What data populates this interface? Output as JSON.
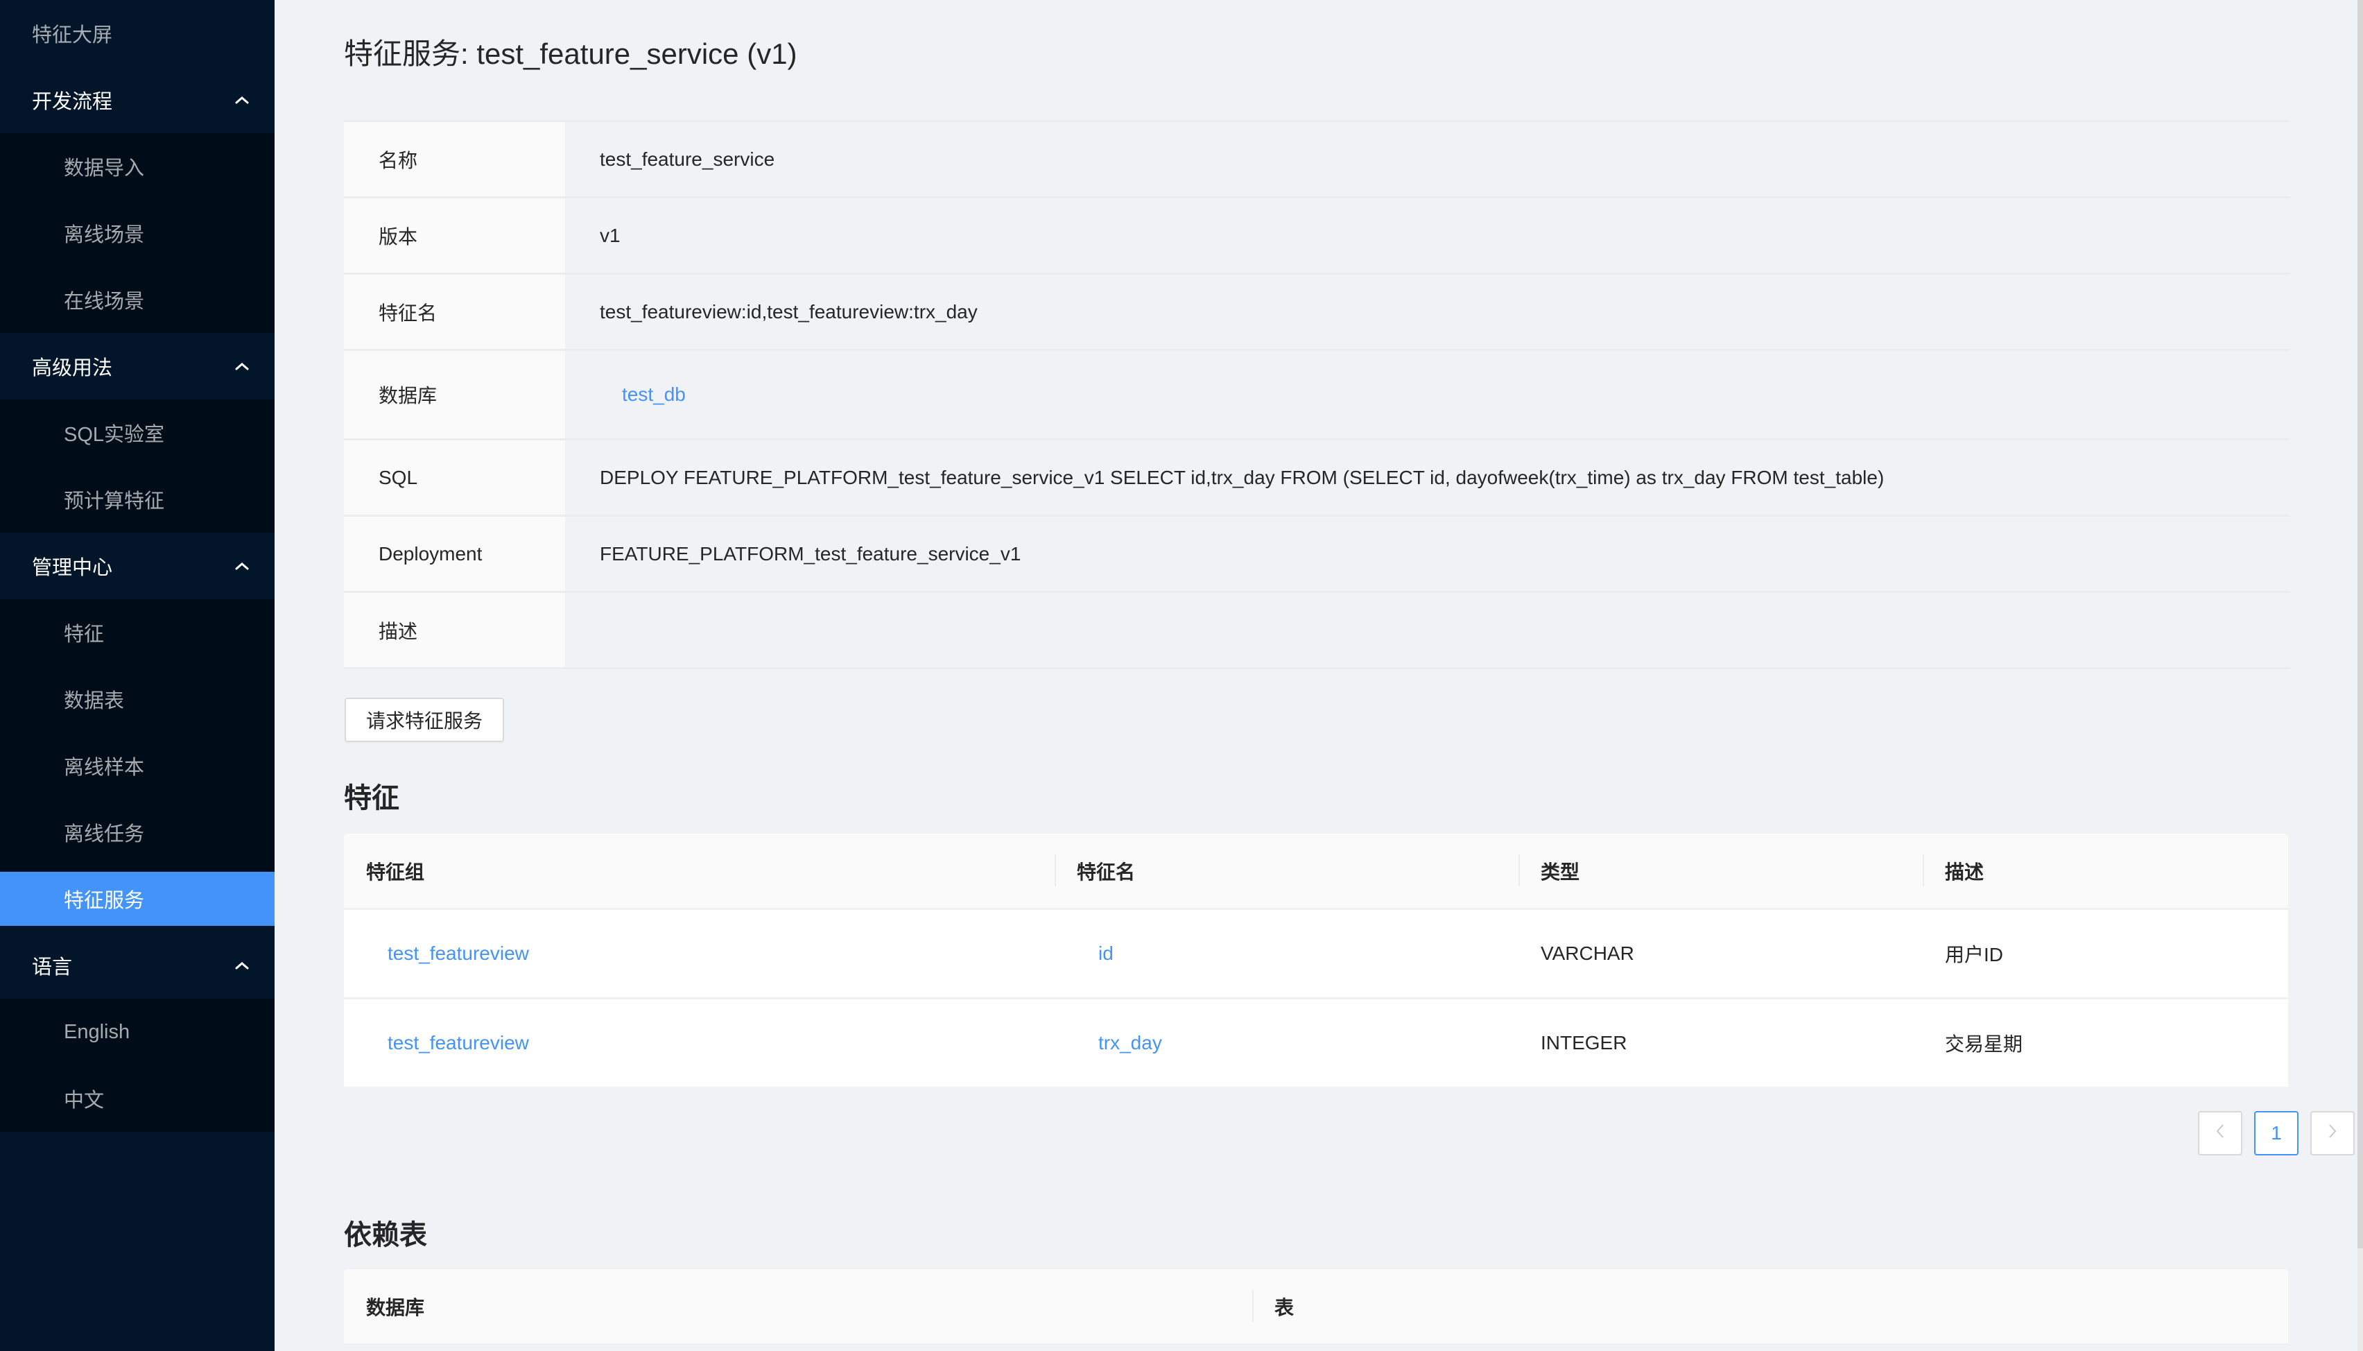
{
  "sidebar": {
    "top_item": "特征大屏",
    "groups": [
      {
        "title": "开发流程",
        "items": [
          "数据导入",
          "离线场景",
          "在线场景"
        ]
      },
      {
        "title": "高级用法",
        "items": [
          "SQL实验室",
          "预计算特征"
        ]
      },
      {
        "title": "管理中心",
        "items": [
          "特征",
          "数据表",
          "离线样本",
          "离线任务",
          "特征服务"
        ]
      },
      {
        "title": "语言",
        "items": [
          "English",
          "中文"
        ]
      }
    ],
    "active_item": "特征服务",
    "colors": {
      "background": "#021529",
      "submenu_background": "#000c17",
      "active": "#4493f8"
    }
  },
  "page": {
    "title": "特征服务: test_feature_service (v1)"
  },
  "details": [
    {
      "label": "名称",
      "value": "test_feature_service"
    },
    {
      "label": "版本",
      "value": "v1"
    },
    {
      "label": "特征名",
      "value": "test_featureview:id,test_featureview:trx_day"
    },
    {
      "label": "数据库",
      "value": "test_db",
      "link": true
    },
    {
      "label": "SQL",
      "value": "DEPLOY FEATURE_PLATFORM_test_feature_service_v1 SELECT id,trx_day FROM (SELECT id, dayofweek(trx_time) as trx_day FROM test_table)"
    },
    {
      "label": "Deployment",
      "value": "FEATURE_PLATFORM_test_feature_service_v1"
    },
    {
      "label": "描述",
      "value": ""
    }
  ],
  "request_button": "请求特征服务",
  "features_section": {
    "title": "特征",
    "columns": [
      "特征组",
      "特征名",
      "类型",
      "描述"
    ],
    "rows": [
      {
        "group": "test_featureview",
        "name": "id",
        "type": "VARCHAR",
        "description": "用户ID"
      },
      {
        "group": "test_featureview",
        "name": "trx_day",
        "type": "INTEGER",
        "description": "交易星期"
      }
    ],
    "pagination": {
      "current_page": "1"
    }
  },
  "dependencies_section": {
    "title": "依赖表",
    "columns": [
      "数据库",
      "表"
    ]
  },
  "colors": {
    "link": "#4493f8",
    "page_background": "#f0f2f5"
  }
}
